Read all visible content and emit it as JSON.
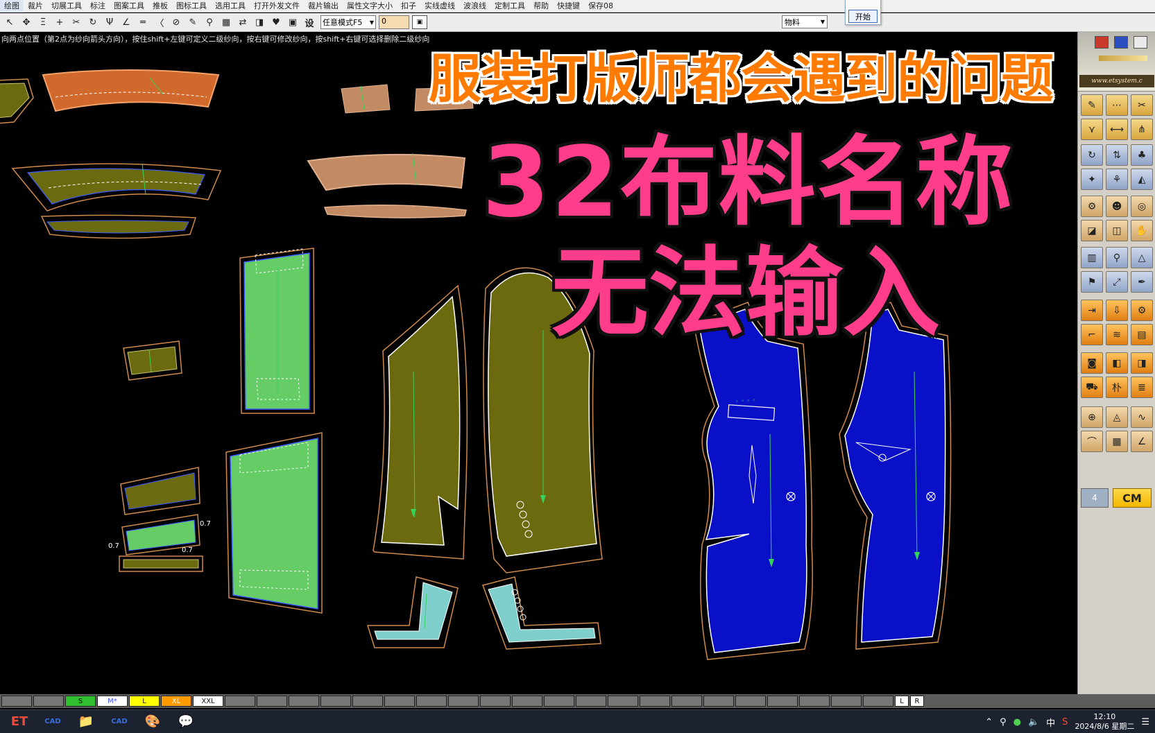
{
  "menu": [
    "绘图",
    "裁片",
    "切展工具",
    "标注",
    "图案工具",
    "推板",
    "图标工具",
    "选用工具",
    "打开外发文件",
    "裁片输出",
    "属性文字大小",
    "扣子",
    "实线虚线",
    "波浪线",
    "定制工具",
    "帮助",
    "快捷键",
    "保存08"
  ],
  "toolbar": {
    "icons": [
      {
        "name": "select-arrow-icon",
        "glyph": "↖"
      },
      {
        "name": "move-icon",
        "glyph": "✥"
      },
      {
        "name": "align-icon",
        "glyph": "Ξ"
      },
      {
        "name": "add-point-icon",
        "glyph": "+"
      },
      {
        "name": "cut-icon",
        "glyph": "✂"
      },
      {
        "name": "rotate-icon",
        "glyph": "↻"
      },
      {
        "name": "fork-icon",
        "glyph": "Ψ"
      },
      {
        "name": "angle-line-icon",
        "glyph": "∠"
      },
      {
        "name": "parallel-line-icon",
        "glyph": "═"
      },
      {
        "name": "curve-icon",
        "glyph": "〈"
      },
      {
        "name": "ruler-icon",
        "glyph": "⊘"
      },
      {
        "name": "pen-icon",
        "glyph": "✎"
      },
      {
        "name": "compass-icon",
        "glyph": "⚲"
      },
      {
        "name": "color-palette-icon",
        "glyph": "▦"
      },
      {
        "name": "flip-icon",
        "glyph": "⇄"
      },
      {
        "name": "measure-icon",
        "glyph": "◨"
      },
      {
        "name": "heart-icon",
        "glyph": "♥"
      },
      {
        "name": "grid-icon",
        "glyph": "▣"
      }
    ],
    "settings_label": "设",
    "mode_select": "任意模式F5",
    "value_input": "0",
    "material_select": "物料",
    "start_button": "开始"
  },
  "hint_text": "向两点位置（第2点为纱向箭头方向），按住shift+左键可定义二级纱向，按右键可修改纱向，按shift+右键可选择删除二级纱向",
  "overlay": {
    "line1": "服装打版师都会遇到的问题",
    "line2": "32布料名称",
    "line3": "无法输入"
  },
  "toolbox": {
    "logo_text": "www.etsystem.c",
    "layer_indicator": "4",
    "cm_label": "CM"
  },
  "pieces": {
    "seam_labels": [
      "0.7",
      "0.7",
      "0.7"
    ]
  },
  "sizes": [
    {
      "label": "S",
      "style": "green"
    },
    {
      "label": "M*",
      "style": "white"
    },
    {
      "label": "L",
      "style": "yellow"
    },
    {
      "label": "XL",
      "style": "orange"
    },
    {
      "label": "XXL",
      "style": "plain"
    }
  ],
  "size_nav": {
    "left": "L",
    "right": "R"
  },
  "taskbar": {
    "apps": [
      "ET",
      "CAD",
      "📁",
      "CAD",
      "🎨",
      "💬"
    ],
    "tray_text": "中",
    "time": "12:10",
    "date": "2024/8/6 星期二"
  }
}
